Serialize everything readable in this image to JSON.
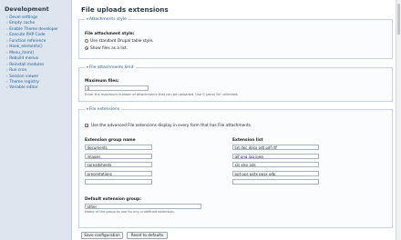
{
  "sidebar": {
    "title": "Development",
    "items": [
      "Devel settings",
      "Empty cache",
      "Enable Theme developer",
      "Execute PHP Code",
      "Function reference",
      "Hook_elements()",
      "Menu_item()",
      "Rebuild menus",
      "Reinstall modules",
      "Run cron",
      "Session viewer",
      "Theme registry",
      "Variable editor"
    ]
  },
  "page": {
    "title": "File uploads extensions"
  },
  "attachments_style": {
    "legend": "Attachments style",
    "field_label": "File attachment style:",
    "options": [
      {
        "label": "Use standard Drupal table style.",
        "selected": false
      },
      {
        "label": "Show files as a list.",
        "selected": true
      }
    ]
  },
  "attachments_limit": {
    "legend": "File attachments limit",
    "field_label": "Maximum files:",
    "value": "0",
    "description": "Enter the maximum number of attachments that can be uploaded. Use 0 (zero) for unlimited."
  },
  "file_extensions": {
    "legend": "File extensions",
    "checkbox_label": "Use the advanced File extensions display in every form that has File attachments.",
    "checkbox_checked": true,
    "col_group": "Extension group name",
    "col_list": "Extension list",
    "rows": [
      {
        "group": "documents",
        "list": "txt doc docx odt pdf rtf"
      },
      {
        "group": "images",
        "list": "gif png jpg jpeg"
      },
      {
        "group": "spreadsheets",
        "list": "xls xlsx ods"
      },
      {
        "group": "presentations",
        "list": "ppt pps pptx ppsx odp"
      },
      {
        "group": "",
        "list": ""
      }
    ],
    "default_label": "Default extension group:",
    "default_value": "other",
    "default_description": "Name of the group to use for any undefined extension."
  },
  "buttons": {
    "save": "Save configuration",
    "reset": "Reset to defaults"
  }
}
